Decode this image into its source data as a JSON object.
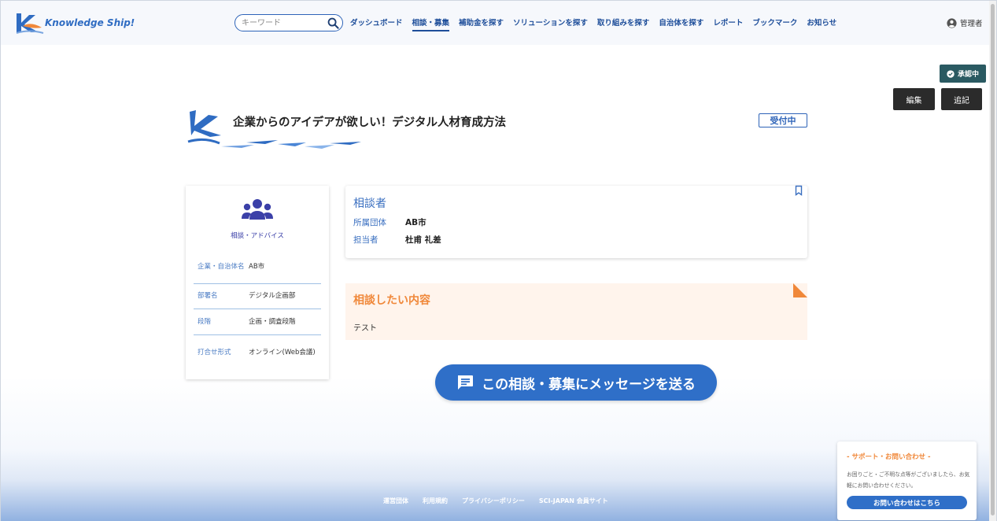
{
  "header": {
    "logo_text": "Knowledge Ship!",
    "search": {
      "placeholder": "キーワード",
      "value": ""
    },
    "nav": [
      {
        "label": "ダッシュボード",
        "active": false
      },
      {
        "label": "相談・募集",
        "active": true
      },
      {
        "label": "補助金を探す",
        "active": false
      },
      {
        "label": "ソリューションを探す",
        "active": false
      },
      {
        "label": "取り組みを探す",
        "active": false
      },
      {
        "label": "自治体を探す",
        "active": false
      },
      {
        "label": "レポート",
        "active": false
      },
      {
        "label": "ブックマーク",
        "active": false
      },
      {
        "label": "お知らせ",
        "active": false
      }
    ],
    "user_label": "管理者"
  },
  "actions": {
    "approval_badge": "承認中",
    "edit_label": "編集",
    "append_label": "追記"
  },
  "page": {
    "title": "企業からのアイデアが欲しい！デジタル人材育成方法",
    "status": "受付中"
  },
  "left_card": {
    "category": "相談・アドバイス",
    "rows": [
      {
        "key": "企業・自治体名",
        "value": "AB市"
      },
      {
        "key": "部署名",
        "value": "デジタル企画部"
      },
      {
        "key": "段階",
        "value": "企画・調査段階"
      },
      {
        "key": "打合せ形式",
        "value": "オンライン(Web会議)"
      }
    ]
  },
  "consultant": {
    "title": "相談者",
    "rows": [
      {
        "key": "所属団体",
        "value": "AB市"
      },
      {
        "key": "担当者",
        "value": "杜甫 礼差"
      }
    ]
  },
  "content": {
    "title": "相談したい内容",
    "text": "テスト"
  },
  "message_button": "この相談・募集にメッセージを送る",
  "footer": {
    "links": [
      "運営団体",
      "利用規約",
      "プライバシーポリシー",
      "SCI-JAPAN 会員サイト"
    ]
  },
  "support": {
    "title": "- サポート・お問い合わせ -",
    "text": "お困りごと・ご不明な点等がございましたら、お気軽にお問い合わせください。",
    "button": "お問い合わせはこちら"
  },
  "colors": {
    "primary": "#2f6fc8",
    "accent_orange": "#f0883a",
    "approval": "#2a5a62",
    "dark_button": "#2b2b2b"
  }
}
